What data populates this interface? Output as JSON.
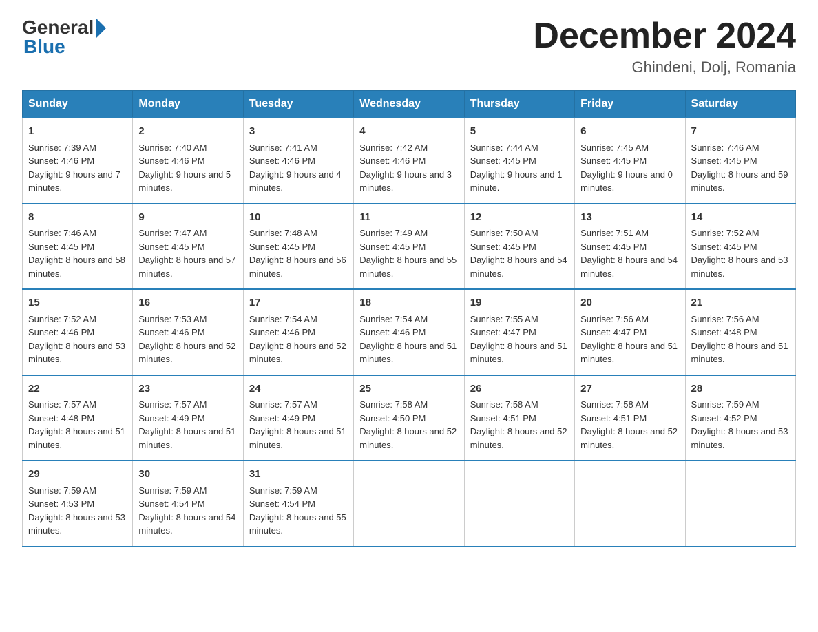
{
  "header": {
    "logo_general": "General",
    "logo_blue": "Blue",
    "month_title": "December 2024",
    "location": "Ghindeni, Dolj, Romania"
  },
  "days_of_week": [
    "Sunday",
    "Monday",
    "Tuesday",
    "Wednesday",
    "Thursday",
    "Friday",
    "Saturday"
  ],
  "weeks": [
    [
      {
        "day": "1",
        "sunrise": "7:39 AM",
        "sunset": "4:46 PM",
        "daylight": "9 hours and 7 minutes."
      },
      {
        "day": "2",
        "sunrise": "7:40 AM",
        "sunset": "4:46 PM",
        "daylight": "9 hours and 5 minutes."
      },
      {
        "day": "3",
        "sunrise": "7:41 AM",
        "sunset": "4:46 PM",
        "daylight": "9 hours and 4 minutes."
      },
      {
        "day": "4",
        "sunrise": "7:42 AM",
        "sunset": "4:46 PM",
        "daylight": "9 hours and 3 minutes."
      },
      {
        "day": "5",
        "sunrise": "7:44 AM",
        "sunset": "4:45 PM",
        "daylight": "9 hours and 1 minute."
      },
      {
        "day": "6",
        "sunrise": "7:45 AM",
        "sunset": "4:45 PM",
        "daylight": "9 hours and 0 minutes."
      },
      {
        "day": "7",
        "sunrise": "7:46 AM",
        "sunset": "4:45 PM",
        "daylight": "8 hours and 59 minutes."
      }
    ],
    [
      {
        "day": "8",
        "sunrise": "7:46 AM",
        "sunset": "4:45 PM",
        "daylight": "8 hours and 58 minutes."
      },
      {
        "day": "9",
        "sunrise": "7:47 AM",
        "sunset": "4:45 PM",
        "daylight": "8 hours and 57 minutes."
      },
      {
        "day": "10",
        "sunrise": "7:48 AM",
        "sunset": "4:45 PM",
        "daylight": "8 hours and 56 minutes."
      },
      {
        "day": "11",
        "sunrise": "7:49 AM",
        "sunset": "4:45 PM",
        "daylight": "8 hours and 55 minutes."
      },
      {
        "day": "12",
        "sunrise": "7:50 AM",
        "sunset": "4:45 PM",
        "daylight": "8 hours and 54 minutes."
      },
      {
        "day": "13",
        "sunrise": "7:51 AM",
        "sunset": "4:45 PM",
        "daylight": "8 hours and 54 minutes."
      },
      {
        "day": "14",
        "sunrise": "7:52 AM",
        "sunset": "4:45 PM",
        "daylight": "8 hours and 53 minutes."
      }
    ],
    [
      {
        "day": "15",
        "sunrise": "7:52 AM",
        "sunset": "4:46 PM",
        "daylight": "8 hours and 53 minutes."
      },
      {
        "day": "16",
        "sunrise": "7:53 AM",
        "sunset": "4:46 PM",
        "daylight": "8 hours and 52 minutes."
      },
      {
        "day": "17",
        "sunrise": "7:54 AM",
        "sunset": "4:46 PM",
        "daylight": "8 hours and 52 minutes."
      },
      {
        "day": "18",
        "sunrise": "7:54 AM",
        "sunset": "4:46 PM",
        "daylight": "8 hours and 51 minutes."
      },
      {
        "day": "19",
        "sunrise": "7:55 AM",
        "sunset": "4:47 PM",
        "daylight": "8 hours and 51 minutes."
      },
      {
        "day": "20",
        "sunrise": "7:56 AM",
        "sunset": "4:47 PM",
        "daylight": "8 hours and 51 minutes."
      },
      {
        "day": "21",
        "sunrise": "7:56 AM",
        "sunset": "4:48 PM",
        "daylight": "8 hours and 51 minutes."
      }
    ],
    [
      {
        "day": "22",
        "sunrise": "7:57 AM",
        "sunset": "4:48 PM",
        "daylight": "8 hours and 51 minutes."
      },
      {
        "day": "23",
        "sunrise": "7:57 AM",
        "sunset": "4:49 PM",
        "daylight": "8 hours and 51 minutes."
      },
      {
        "day": "24",
        "sunrise": "7:57 AM",
        "sunset": "4:49 PM",
        "daylight": "8 hours and 51 minutes."
      },
      {
        "day": "25",
        "sunrise": "7:58 AM",
        "sunset": "4:50 PM",
        "daylight": "8 hours and 52 minutes."
      },
      {
        "day": "26",
        "sunrise": "7:58 AM",
        "sunset": "4:51 PM",
        "daylight": "8 hours and 52 minutes."
      },
      {
        "day": "27",
        "sunrise": "7:58 AM",
        "sunset": "4:51 PM",
        "daylight": "8 hours and 52 minutes."
      },
      {
        "day": "28",
        "sunrise": "7:59 AM",
        "sunset": "4:52 PM",
        "daylight": "8 hours and 53 minutes."
      }
    ],
    [
      {
        "day": "29",
        "sunrise": "7:59 AM",
        "sunset": "4:53 PM",
        "daylight": "8 hours and 53 minutes."
      },
      {
        "day": "30",
        "sunrise": "7:59 AM",
        "sunset": "4:54 PM",
        "daylight": "8 hours and 54 minutes."
      },
      {
        "day": "31",
        "sunrise": "7:59 AM",
        "sunset": "4:54 PM",
        "daylight": "8 hours and 55 minutes."
      },
      null,
      null,
      null,
      null
    ]
  ]
}
